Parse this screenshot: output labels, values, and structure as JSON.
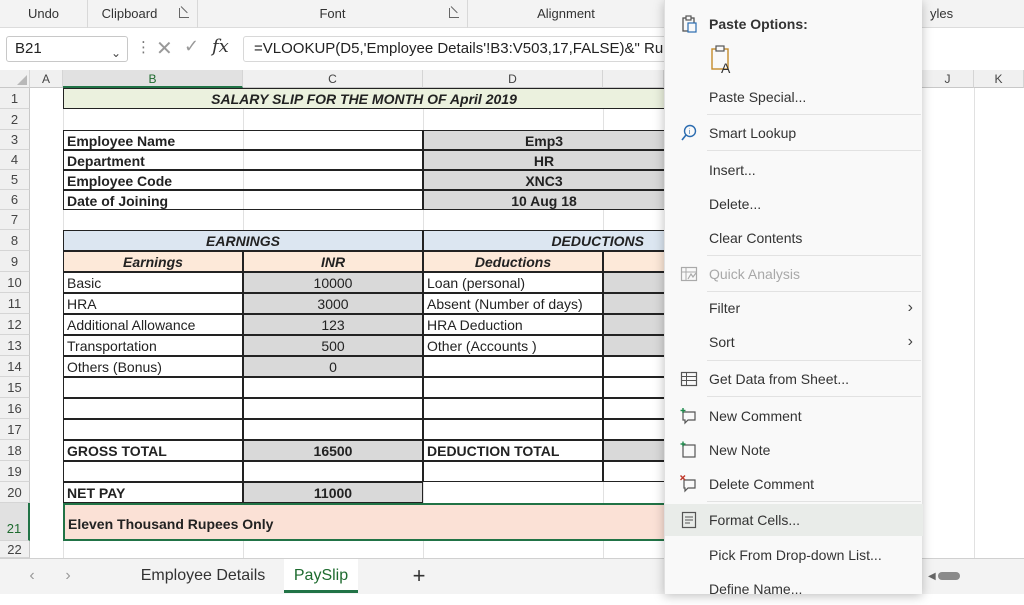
{
  "ribbon": {
    "undo": "Undo",
    "clipboard": "Clipboard",
    "font": "Font",
    "alignment": "Alignment",
    "styles_partial": "yles"
  },
  "formula_bar": {
    "name_box": "B21",
    "fx": "fx",
    "formula": "=VLOOKUP(D5,'Employee Details'!B3:V503,17,FALSE)&\" Ru"
  },
  "columns": [
    "A",
    "B",
    "C",
    "D",
    "J",
    "K"
  ],
  "rows": [
    "1",
    "2",
    "3",
    "4",
    "5",
    "6",
    "7",
    "8",
    "9",
    "10",
    "11",
    "12",
    "13",
    "14",
    "15",
    "16",
    "17",
    "18",
    "19",
    "20",
    "21",
    "22"
  ],
  "sheet": {
    "title": "SALARY SLIP FOR THE MONTH OF April 2019",
    "info": [
      {
        "label": "Employee Name",
        "value": "Emp3"
      },
      {
        "label": "Department",
        "value": "HR"
      },
      {
        "label": "Employee Code",
        "value": "XNC3"
      },
      {
        "label": "Date of Joining",
        "value": "10 Aug 18"
      }
    ],
    "earnings_header": "EARNINGS",
    "deductions_header": "DEDUCTIONS",
    "earnings_col": "Earnings",
    "inr_col": "INR",
    "deductions_col": "Deductions",
    "earnings": [
      {
        "name": "Basic",
        "amount": "10000"
      },
      {
        "name": "HRA",
        "amount": "3000"
      },
      {
        "name": "Additional Allowance",
        "amount": "123"
      },
      {
        "name": "Transportation",
        "amount": "500"
      },
      {
        "name": "Others (Bonus)",
        "amount": "0"
      }
    ],
    "deductions": [
      "Loan (personal)",
      "Absent (Number of days)",
      "HRA Deduction",
      "Other (Accounts )"
    ],
    "gross_total_label": "GROSS TOTAL",
    "gross_total": "16500",
    "deduction_total_label": "DEDUCTION TOTAL",
    "net_pay_label": "NET PAY",
    "net_pay": "11000",
    "amount_words": "Eleven Thousand   Rupees Only"
  },
  "context_menu": {
    "paste_options": "Paste Options:",
    "items": [
      {
        "label": "Paste Special...",
        "icon": "none"
      },
      {
        "label": "Smart Lookup",
        "icon": "smart-lookup-icon"
      },
      {
        "label": "Insert...",
        "icon": "none"
      },
      {
        "label": "Delete...",
        "icon": "none"
      },
      {
        "label": "Clear Contents",
        "icon": "none"
      },
      {
        "label": "Quick Analysis",
        "icon": "quick-analysis-icon",
        "disabled": true
      },
      {
        "label": "Filter",
        "icon": "none",
        "submenu": true
      },
      {
        "label": "Sort",
        "icon": "none",
        "submenu": true
      },
      {
        "label": "Get Data from Sheet...",
        "icon": "table-icon"
      },
      {
        "label": "New Comment",
        "icon": "new-comment-icon"
      },
      {
        "label": "New Note",
        "icon": "new-note-icon"
      },
      {
        "label": "Delete Comment",
        "icon": "delete-comment-icon"
      },
      {
        "label": "Format Cells...",
        "icon": "format-cells-icon",
        "highlighted": true
      },
      {
        "label": "Pick From Drop-down List...",
        "icon": "none"
      },
      {
        "label": "Define Name...",
        "icon": "none"
      }
    ]
  },
  "tabs": {
    "employee_details": "Employee Details",
    "payslip": "PaySlip",
    "add": "+"
  },
  "colors": {
    "accent": "#217346",
    "header_fill": "#ebf1de",
    "section_fill": "#dce6f1",
    "col_fill": "#fde9d9",
    "value_fill": "#d9d9d9",
    "words_fill": "#fbe1d6"
  }
}
